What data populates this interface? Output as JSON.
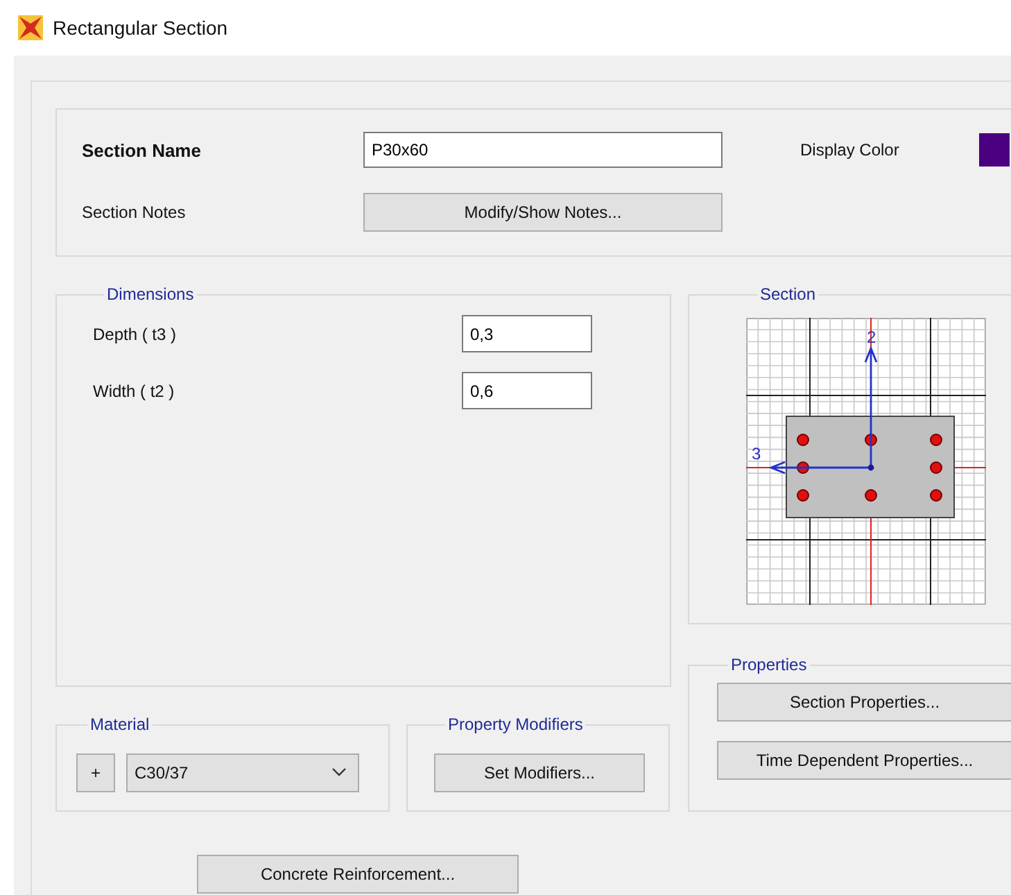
{
  "window": {
    "title": "Rectangular Section"
  },
  "header": {
    "section_name": {
      "label": "Section Name",
      "value": "P30x60"
    },
    "display_color": {
      "label": "Display Color",
      "color": "#4b0082"
    },
    "section_notes": {
      "label": "Section Notes",
      "button": "Modify/Show Notes..."
    }
  },
  "dimensions": {
    "title": "Dimensions",
    "fields": [
      {
        "label": "Depth ( t3 )",
        "value": "0,3"
      },
      {
        "label": "Width ( t2 )",
        "value": "0,6"
      }
    ]
  },
  "section": {
    "title": "Section",
    "axis_labels": [
      "2",
      "3"
    ]
  },
  "properties": {
    "title": "Properties",
    "buttons": [
      "Section Properties...",
      "Time Dependent Properties..."
    ]
  },
  "material": {
    "title": "Material",
    "add_button": "+",
    "value": "C30/37"
  },
  "property_modifiers": {
    "title": "Property Modifiers",
    "button": "Set Modifiers..."
  },
  "footer_button": "Concrete Reinforcement..."
}
